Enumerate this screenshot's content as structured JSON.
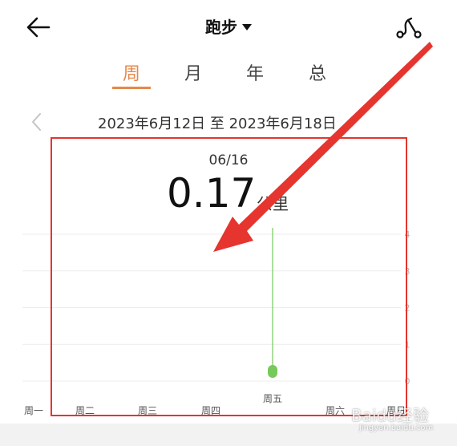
{
  "header": {
    "title": "跑步",
    "back_icon": "arrow-left-icon",
    "route_icon": "route-share-icon"
  },
  "tabs": [
    {
      "label": "周",
      "active": true
    },
    {
      "label": "月",
      "active": false
    },
    {
      "label": "年",
      "active": false
    },
    {
      "label": "总",
      "active": false
    }
  ],
  "date_range": {
    "text": "2023年6月12日 至 2023年6月18日",
    "prev_icon": "chevron-left-icon",
    "next_icon": "chevron-right-icon"
  },
  "summary": {
    "selected_date": "06/16",
    "value": "0.17",
    "unit": "公里"
  },
  "colors": {
    "accent": "#e5894a",
    "bar": "#76c95a",
    "annotation": "#e5352e"
  },
  "chart_data": {
    "type": "bar",
    "categories": [
      "周一",
      "周二",
      "周三",
      "周四",
      "周五",
      "周六",
      "周日"
    ],
    "values": [
      0,
      0,
      0,
      0,
      0.17,
      0,
      0
    ],
    "selected_index": 4,
    "yticks": [
      0,
      1,
      2,
      3,
      4
    ],
    "ylim": [
      0,
      4
    ],
    "grid": true,
    "title": "",
    "xlabel": "",
    "ylabel": ""
  },
  "watermark": {
    "text": "Baidu经验",
    "sub": "jingyan.baidu.com"
  }
}
